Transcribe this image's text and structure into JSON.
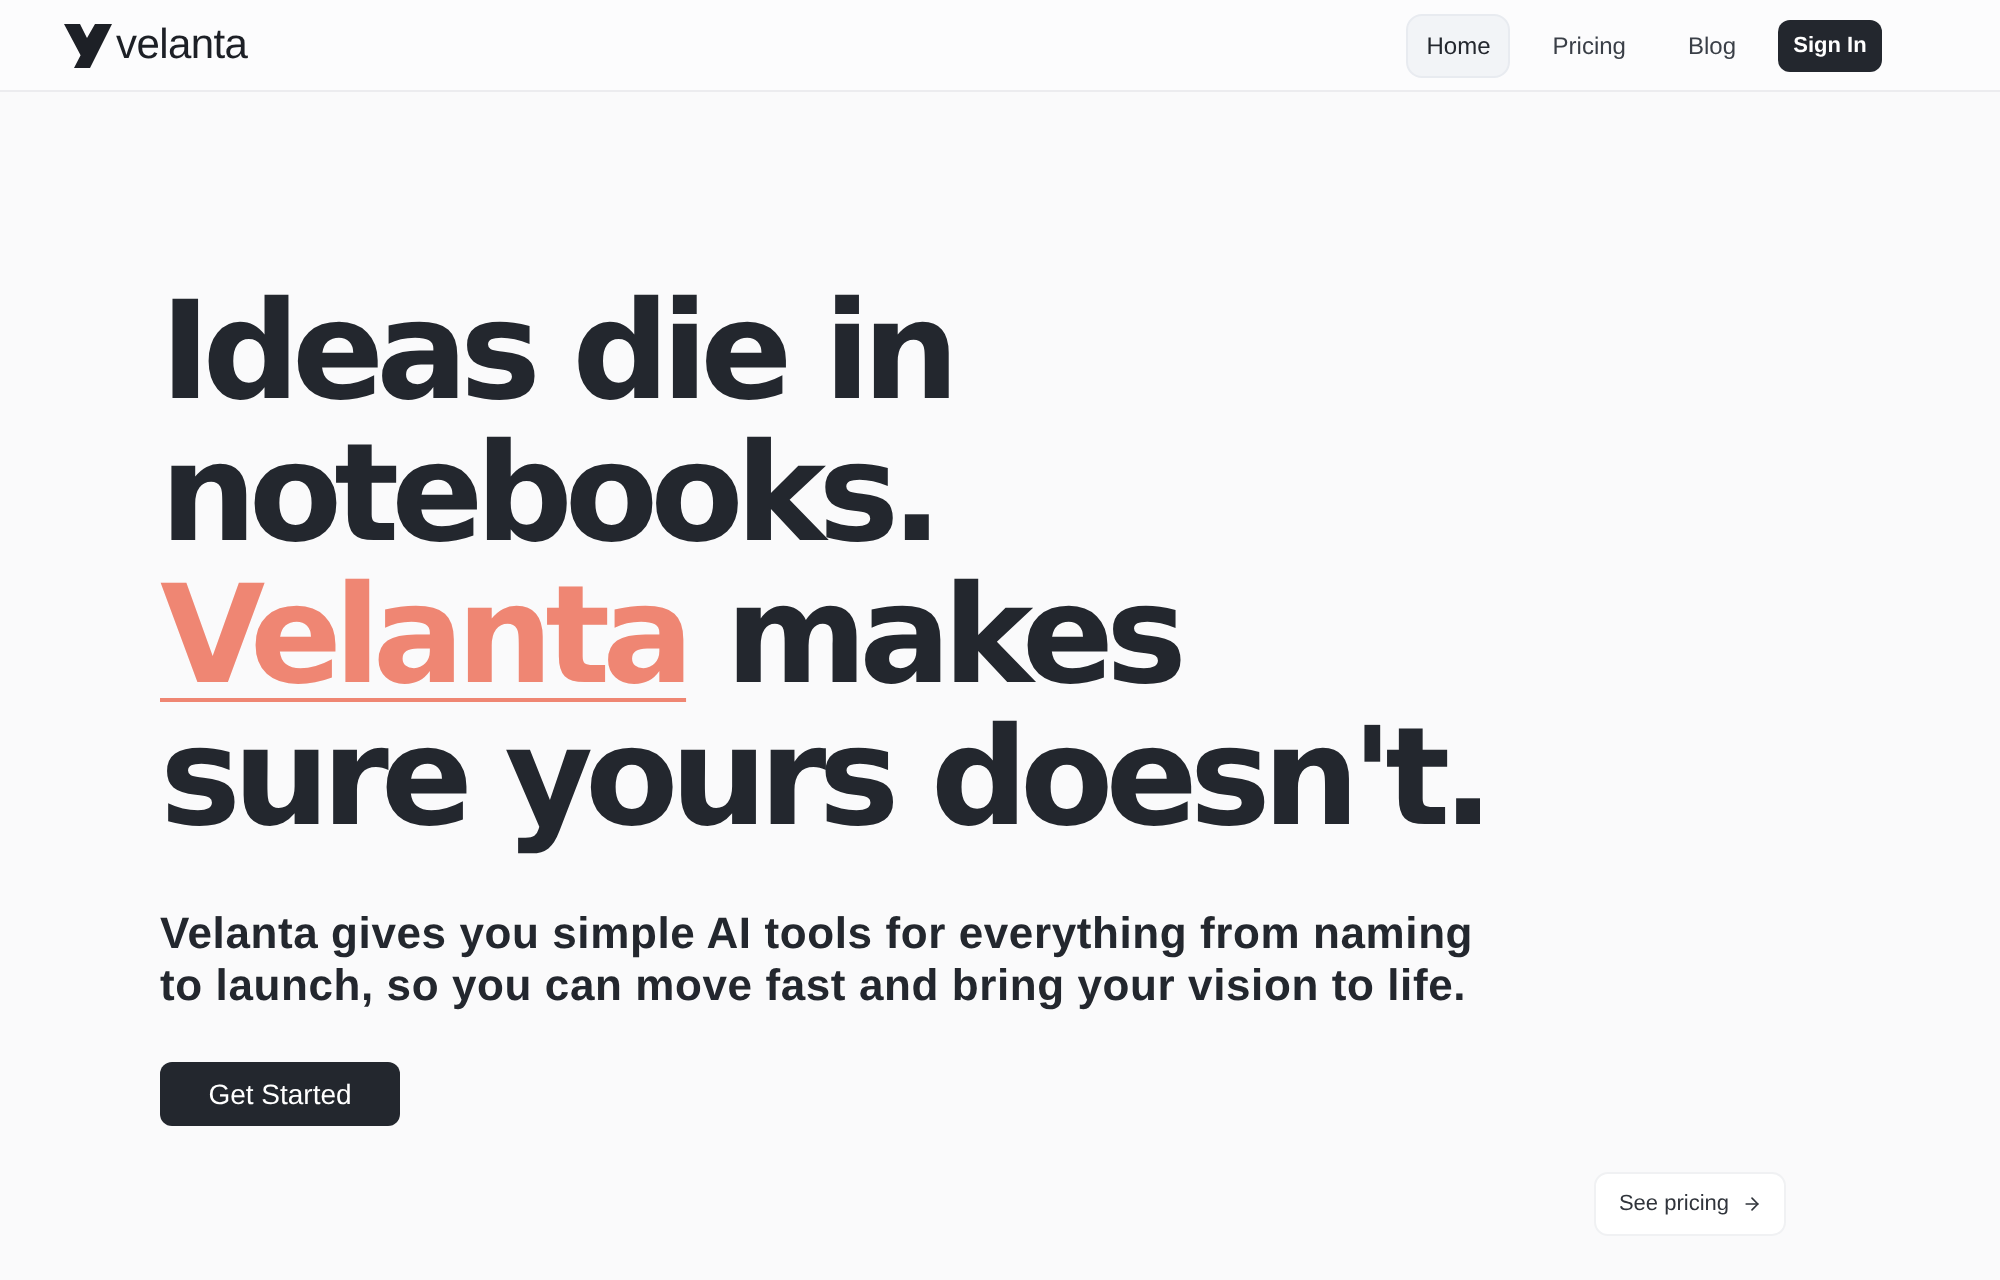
{
  "header": {
    "logo_text": "velanta",
    "nav": [
      {
        "label": "Home",
        "selected": true
      },
      {
        "label": "Pricing",
        "selected": false
      },
      {
        "label": "Blog",
        "selected": false
      }
    ],
    "sign_in": "Sign In"
  },
  "hero": {
    "headline": [
      [
        {
          "text": "Ideas die in",
          "highlighted": false
        }
      ],
      [
        {
          "text": "notebooks.",
          "highlighted": false
        }
      ],
      [
        {
          "text": "Velanta",
          "highlighted": true
        },
        {
          "text": "makes",
          "highlighted": false
        }
      ],
      [
        {
          "text": "sure yours doesn't.",
          "highlighted": false
        }
      ]
    ],
    "subtitle": "Velanta gives you simple AI tools for everything from naming to launch, so you can move fast and bring your vision to life.",
    "cta": "Get Started"
  },
  "see_pricing": "See pricing"
}
